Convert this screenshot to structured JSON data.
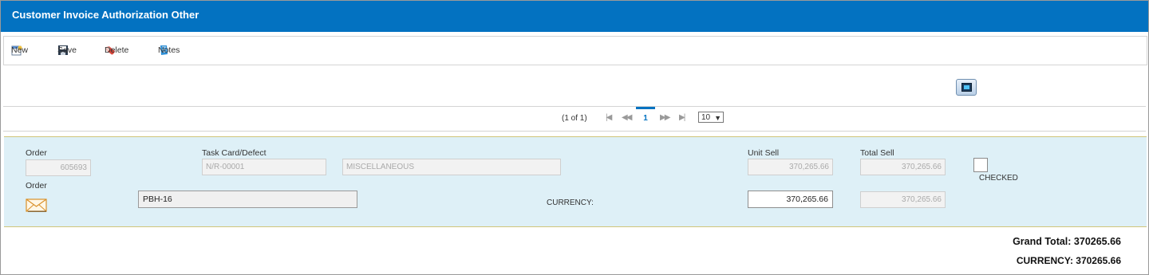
{
  "window": {
    "title": "Customer Invoice Authorization Other"
  },
  "toolbar": {
    "new_label": "New",
    "save_label": "Save",
    "delete_label": "Delete",
    "notes_label": "Notes"
  },
  "pager": {
    "info": "(1 of 1)",
    "current_page": "1",
    "page_size": "10",
    "first_glyph": "|◀",
    "prev_glyph": "◀◀",
    "next_glyph": "▶▶",
    "last_glyph": "▶|"
  },
  "row": {
    "order_label": "Order",
    "order_value": "605693",
    "task_card_label": "Task Card/Defect",
    "task_card_value": "N/R-00001",
    "description_value": "MISCELLANEOUS",
    "unit_sell_label": "Unit Sell",
    "unit_sell_value": "370,265.66",
    "total_sell_label": "Total Sell",
    "total_sell_value": "370,265.66",
    "checked_label": "CHECKED",
    "order_label_2": "Order",
    "reference_value": "PBH-16",
    "currency_label": "CURRENCY:",
    "currency_unit_value": "370,265.66",
    "currency_total_value": "370,265.66"
  },
  "totals": {
    "grand_total": "Grand Total: 370265.66",
    "currency_total": "CURRENCY: 370265.66"
  },
  "colors": {
    "title_bar": "#0372c1",
    "row_background": "#def0f7",
    "accent": "#0372c1"
  },
  "icons": [
    "new-icon",
    "save-icon",
    "delete-icon",
    "notes-icon",
    "export-icon",
    "mail-icon"
  ]
}
